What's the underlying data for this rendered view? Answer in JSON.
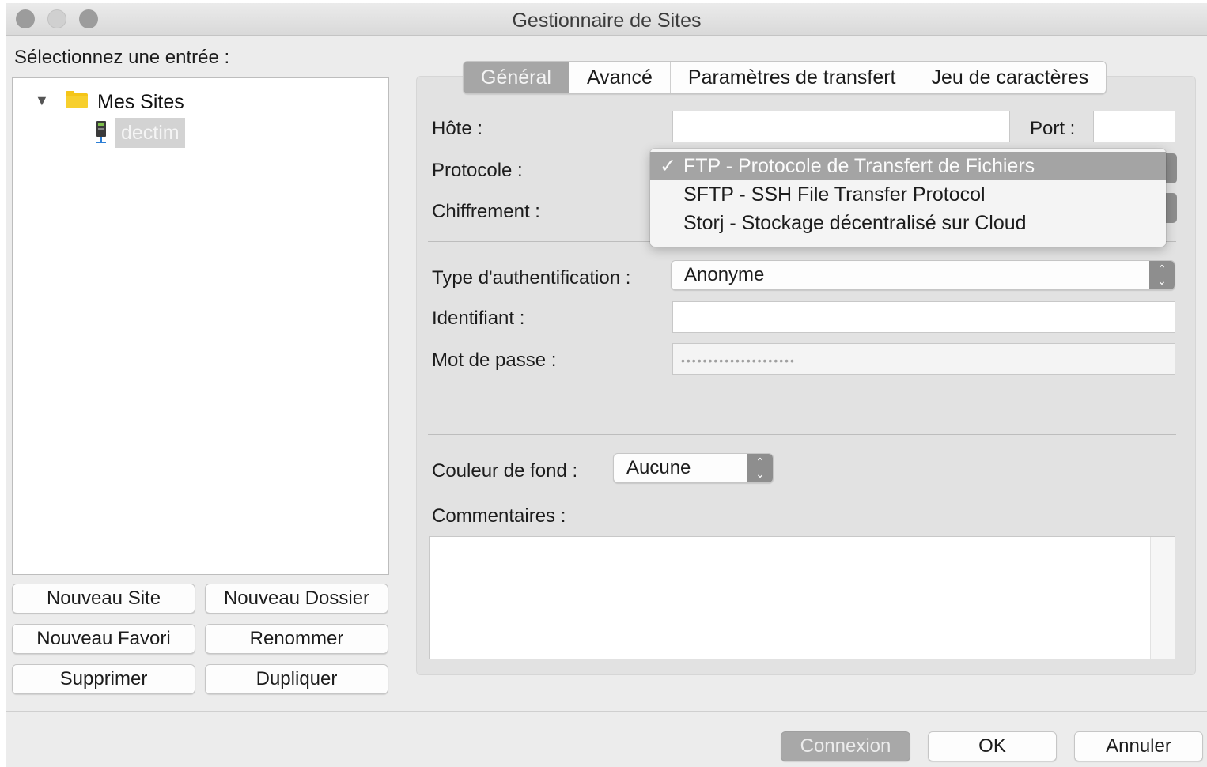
{
  "window": {
    "title": "Gestionnaire de Sites"
  },
  "left": {
    "select_label": "Sélectionnez une entrée :",
    "tree": {
      "root": {
        "label": "Mes Sites",
        "expanded": true,
        "icon": "folder-icon"
      },
      "children": [
        {
          "label": "dectim",
          "icon": "server-icon",
          "selected": true
        }
      ]
    },
    "buttons": {
      "new_site": "Nouveau Site",
      "new_folder": "Nouveau Dossier",
      "new_bookmark": "Nouveau Favori",
      "rename": "Renommer",
      "delete": "Supprimer",
      "duplicate": "Dupliquer"
    }
  },
  "tabs": [
    {
      "label": "Général",
      "active": true
    },
    {
      "label": "Avancé",
      "active": false
    },
    {
      "label": "Paramètres de transfert",
      "active": false
    },
    {
      "label": "Jeu de caractères",
      "active": false
    }
  ],
  "general": {
    "host_label": "Hôte :",
    "host_value": "",
    "port_label": "Port :",
    "port_value": "",
    "protocol_label": "Protocole :",
    "encryption_label": "Chiffrement :",
    "auth_label": "Type d'authentification :",
    "auth_value": "Anonyme",
    "user_label": "Identifiant :",
    "user_value": "",
    "password_label": "Mot de passe :",
    "password_mask": "•••••••••••••••••••••",
    "bgcolor_label": "Couleur de fond :",
    "bgcolor_value": "Aucune",
    "comments_label": "Commentaires :",
    "comments_value": ""
  },
  "protocol_dropdown": {
    "check": "✓",
    "options": [
      {
        "label": "FTP - Protocole de Transfert de Fichiers",
        "selected": true
      },
      {
        "label": "SFTP - SSH File Transfer Protocol",
        "selected": false
      },
      {
        "label": "Storj - Stockage décentralisé sur Cloud",
        "selected": false
      }
    ]
  },
  "footer": {
    "connect": "Connexion",
    "ok": "OK",
    "cancel": "Annuler"
  },
  "colors": {
    "selection": "#a4a4a4",
    "window_bg": "#ececec",
    "folder": "#f5c518"
  }
}
